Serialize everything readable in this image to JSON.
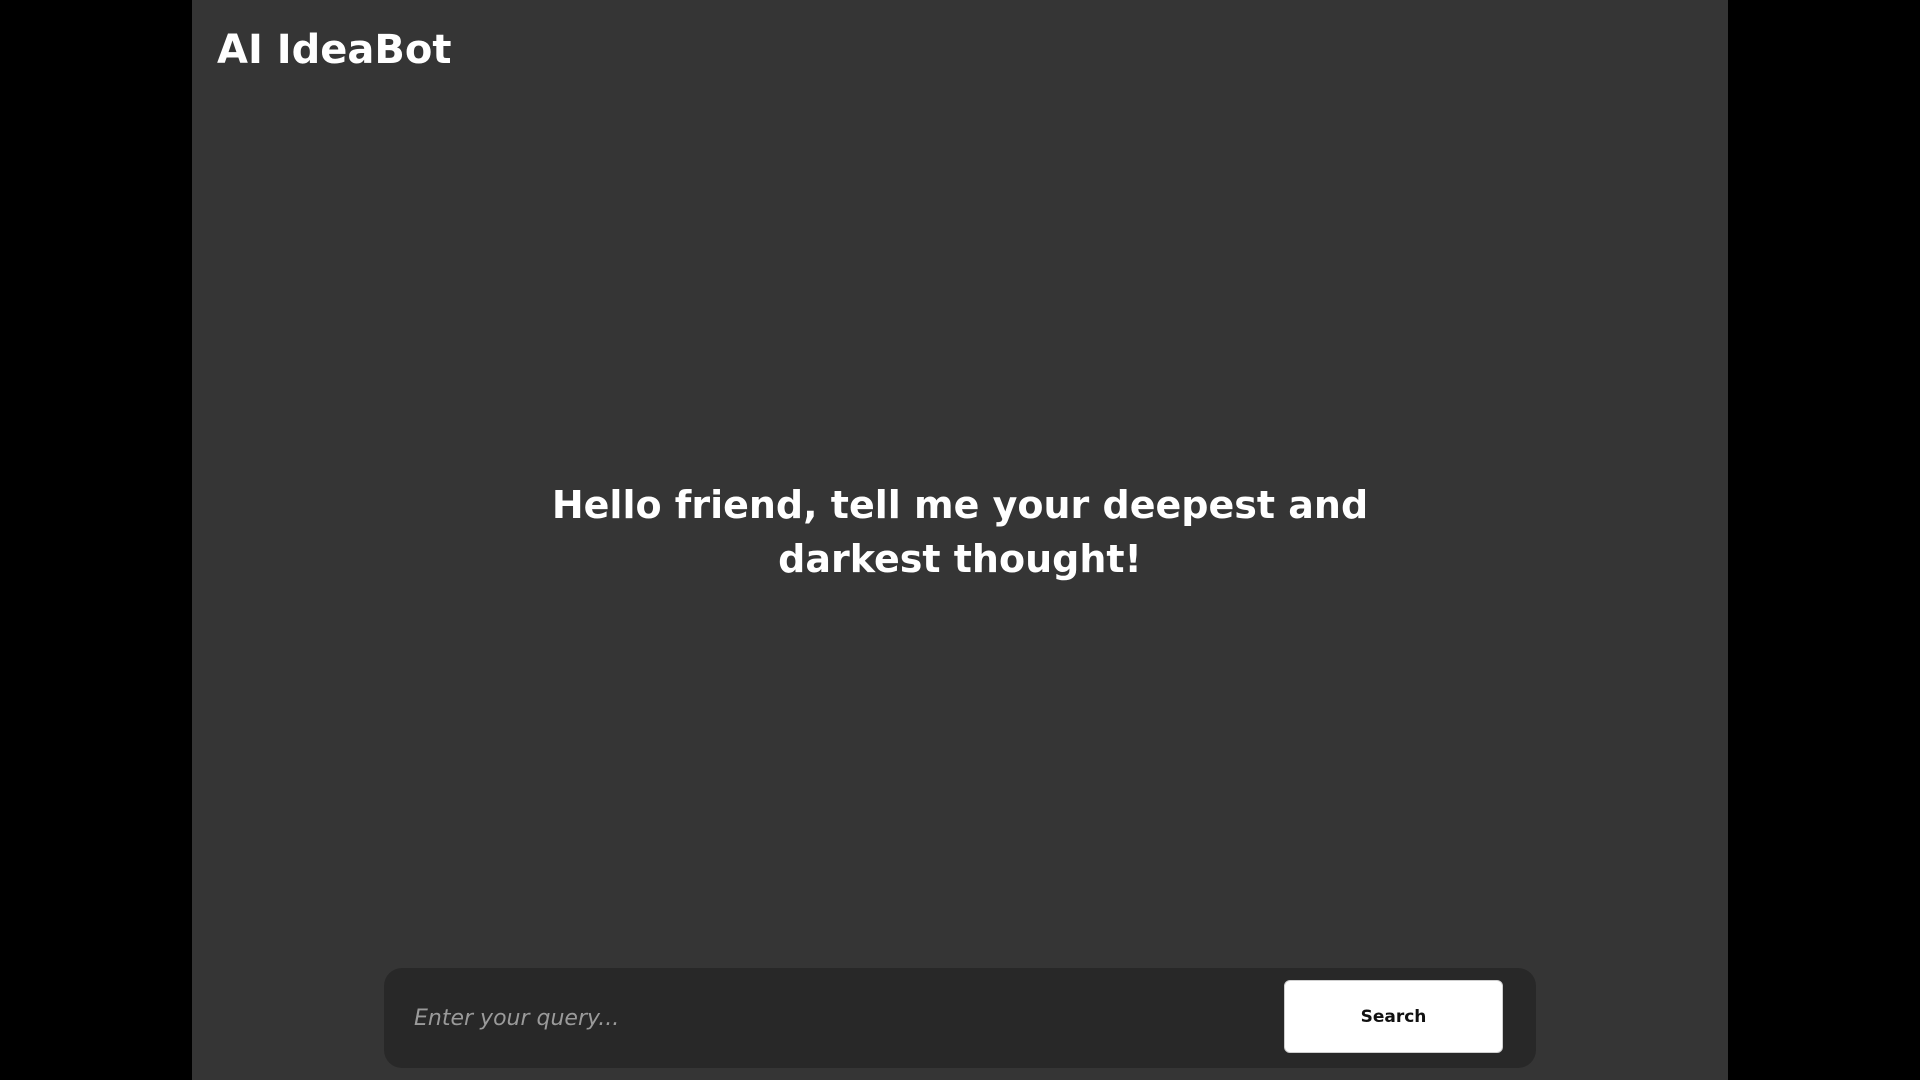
{
  "app": {
    "title": "AI IdeaBot",
    "background_color": "#353535",
    "side_background_color": "#000000"
  },
  "main": {
    "greeting": "Hello friend, tell me your deepest and darkest thought!"
  },
  "query_bar": {
    "input_value": "",
    "input_placeholder": "Enter your query...",
    "search_label": "Search",
    "bar_color": "#282828",
    "button_color": "#ffffff"
  }
}
